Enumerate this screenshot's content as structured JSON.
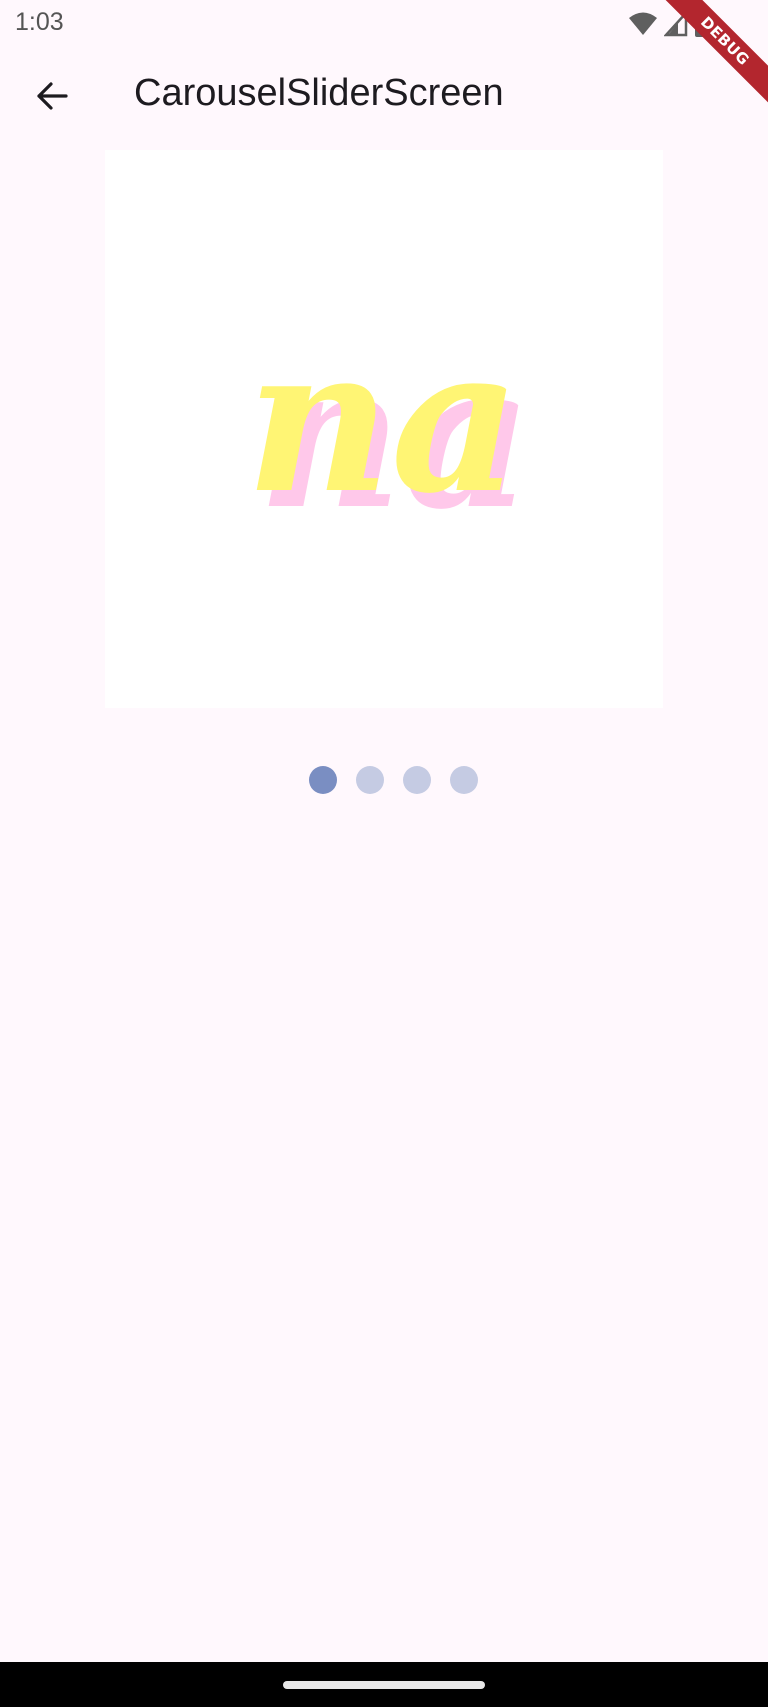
{
  "status_bar": {
    "time": "1:03",
    "icons": [
      "wifi-icon",
      "cellular-signal-icon",
      "battery-icon"
    ]
  },
  "debug_banner": {
    "label": "DEBUG",
    "color": "#b3262e"
  },
  "app_bar": {
    "title": "CarouselSliderScreen",
    "back_icon": "arrow-back-icon"
  },
  "carousel": {
    "current_slide": {
      "text": "na",
      "text_color": "#fff574",
      "shadow_color": "#ffc8ea",
      "background": "#ffffff"
    },
    "slide_count": 4,
    "active_index": 0,
    "indicator_active_color": "#7a8ec2",
    "indicator_inactive_color": "#c5cbe3"
  },
  "theme": {
    "background": "#fff8fd",
    "nav_bar": "#000000"
  }
}
